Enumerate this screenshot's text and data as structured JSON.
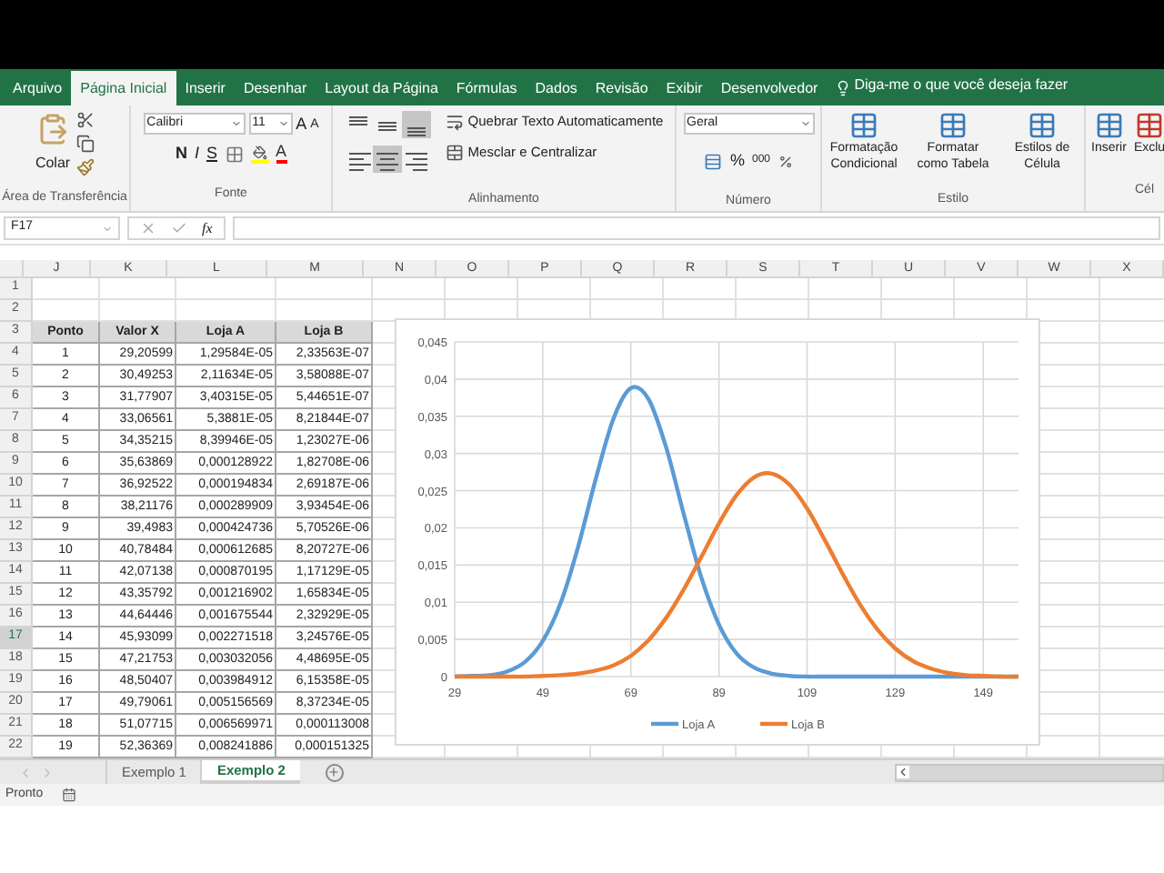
{
  "ribbon_tabs": [
    {
      "label": "Arquivo",
      "selected": false
    },
    {
      "label": "Página Inicial",
      "selected": true
    },
    {
      "label": "Inserir",
      "selected": false
    },
    {
      "label": "Desenhar",
      "selected": false
    },
    {
      "label": "Layout da Página",
      "selected": false
    },
    {
      "label": "Fórmulas",
      "selected": false
    },
    {
      "label": "Dados",
      "selected": false
    },
    {
      "label": "Revisão",
      "selected": false
    },
    {
      "label": "Exibir",
      "selected": false
    },
    {
      "label": "Desenvolvedor",
      "selected": false
    }
  ],
  "tell_me": "Diga-me o que você deseja fazer",
  "clipboard": {
    "paste": "Colar",
    "label": "Área de Transferência"
  },
  "font": {
    "name": "Calibri",
    "size": "11",
    "grow": "A",
    "shrink": "A",
    "bold": "N",
    "italic": "I",
    "underline": "S",
    "color_letter": "A",
    "label": "Fonte"
  },
  "alignment": {
    "wrap": "Quebrar Texto Automaticamente",
    "merge": "Mesclar e Centralizar",
    "label": "Alinhamento",
    "vertical_align": [
      {
        "selected": false
      },
      {
        "selected": false
      },
      {
        "selected": true
      }
    ],
    "horizontal_align": [
      {
        "selected": false
      },
      {
        "selected": true
      },
      {
        "selected": false
      }
    ]
  },
  "number": {
    "format": "Geral",
    "percent": "%",
    "thousands": "000",
    "label": "Número"
  },
  "styles": {
    "conditional": "Formatação Condicional",
    "table": "Formatar como Tabela",
    "cell": "Estilos de Célula",
    "label": "Estilo"
  },
  "cells": {
    "insert": "Inserir",
    "delete": "Exclu",
    "label": "Cél"
  },
  "formula_bar": {
    "name_box": "F17",
    "fx": "fx"
  },
  "columns": [
    "J",
    "K",
    "L",
    "M",
    "N",
    "O",
    "P",
    "Q",
    "R",
    "S",
    "T",
    "U",
    "V",
    "W",
    "X"
  ],
  "rows": [
    {
      "number": "1",
      "selected": false,
      "kind": "data",
      "cells": []
    },
    {
      "number": "2",
      "selected": false,
      "kind": "data",
      "cells": []
    },
    {
      "number": "3",
      "selected": false,
      "kind": "header",
      "cells": [
        "Ponto",
        "Valor X",
        "Loja A",
        "Loja B"
      ]
    },
    {
      "number": "4",
      "selected": false,
      "kind": "data",
      "cells": [
        "1",
        "29,20599",
        "1,29584E-05",
        "2,33563E-07"
      ]
    },
    {
      "number": "5",
      "selected": false,
      "kind": "data",
      "cells": [
        "2",
        "30,49253",
        "2,11634E-05",
        "3,58088E-07"
      ]
    },
    {
      "number": "6",
      "selected": false,
      "kind": "data",
      "cells": [
        "3",
        "31,77907",
        "3,40315E-05",
        "5,44651E-07"
      ]
    },
    {
      "number": "7",
      "selected": false,
      "kind": "data",
      "cells": [
        "4",
        "33,06561",
        "5,3881E-05",
        "8,21844E-07"
      ]
    },
    {
      "number": "8",
      "selected": false,
      "kind": "data",
      "cells": [
        "5",
        "34,35215",
        "8,39946E-05",
        "1,23027E-06"
      ]
    },
    {
      "number": "9",
      "selected": false,
      "kind": "data",
      "cells": [
        "6",
        "35,63869",
        "0,000128922",
        "1,82708E-06"
      ]
    },
    {
      "number": "10",
      "selected": false,
      "kind": "data",
      "cells": [
        "7",
        "36,92522",
        "0,000194834",
        "2,69187E-06"
      ]
    },
    {
      "number": "11",
      "selected": false,
      "kind": "data",
      "cells": [
        "8",
        "38,21176",
        "0,000289909",
        "3,93454E-06"
      ]
    },
    {
      "number": "12",
      "selected": false,
      "kind": "data",
      "cells": [
        "9",
        "39,4983",
        "0,000424736",
        "5,70526E-06"
      ]
    },
    {
      "number": "13",
      "selected": false,
      "kind": "data",
      "cells": [
        "10",
        "40,78484",
        "0,000612685",
        "8,20727E-06"
      ]
    },
    {
      "number": "14",
      "selected": false,
      "kind": "data",
      "cells": [
        "11",
        "42,07138",
        "0,000870195",
        "1,17129E-05"
      ]
    },
    {
      "number": "15",
      "selected": false,
      "kind": "data",
      "cells": [
        "12",
        "43,35792",
        "0,001216902",
        "1,65834E-05"
      ]
    },
    {
      "number": "16",
      "selected": false,
      "kind": "data",
      "cells": [
        "13",
        "44,64446",
        "0,001675544",
        "2,32929E-05"
      ]
    },
    {
      "number": "17",
      "selected": true,
      "kind": "data",
      "cells": [
        "14",
        "45,93099",
        "0,002271518",
        "3,24576E-05"
      ]
    },
    {
      "number": "18",
      "selected": false,
      "kind": "data",
      "cells": [
        "15",
        "47,21753",
        "0,003032056",
        "4,48695E-05"
      ]
    },
    {
      "number": "19",
      "selected": false,
      "kind": "data",
      "cells": [
        "16",
        "48,50407",
        "0,003984912",
        "6,15358E-05"
      ]
    },
    {
      "number": "20",
      "selected": false,
      "kind": "data",
      "cells": [
        "17",
        "49,79061",
        "0,005156569",
        "8,37234E-05"
      ]
    },
    {
      "number": "21",
      "selected": false,
      "kind": "data",
      "cells": [
        "18",
        "51,07715",
        "0,006569971",
        "0,000113008"
      ]
    },
    {
      "number": "22",
      "selected": false,
      "kind": "data",
      "cells": [
        "19",
        "52,36369",
        "0,008241886",
        "0,000151325"
      ]
    }
  ],
  "chart": {
    "chart_data": {
      "type": "line",
      "x": [
        29,
        33,
        37,
        41,
        45,
        49,
        53,
        57,
        61,
        65,
        69,
        73,
        77,
        81,
        85,
        89,
        93,
        97,
        101,
        105,
        109,
        113,
        117,
        121,
        125,
        129,
        133,
        137,
        141,
        145,
        149,
        153,
        157
      ],
      "series": [
        {
          "name": "Loja A",
          "color": "#5b9bd5",
          "values": [
            0,
            0.0001,
            0.0002,
            0.0007,
            0.002,
            0.0048,
            0.0098,
            0.0174,
            0.0265,
            0.0346,
            0.0388,
            0.0373,
            0.0308,
            0.0219,
            0.0133,
            0.007,
            0.0031,
            0.0012,
            0.0004,
            0.0001,
            0,
            0,
            0,
            0,
            0,
            0,
            0,
            0,
            0,
            0,
            0,
            0,
            0
          ]
        },
        {
          "name": "Loja B",
          "color": "#ed7d31",
          "values": [
            0,
            0,
            0,
            0,
            0,
            0.0001,
            0.0002,
            0.0004,
            0.0008,
            0.0015,
            0.0028,
            0.0049,
            0.0079,
            0.0117,
            0.0161,
            0.0206,
            0.0244,
            0.0268,
            0.0273,
            0.0258,
            0.0226,
            0.0184,
            0.0139,
            0.0097,
            0.0063,
            0.0038,
            0.0021,
            0.0011,
            0.0005,
            0.0002,
            0.0001,
            0,
            0
          ]
        }
      ],
      "grid": true,
      "legend": "bottom",
      "xlim": [
        29,
        157
      ],
      "ylim": [
        0,
        0.045
      ],
      "xticks": [
        29,
        49,
        69,
        89,
        109,
        129,
        149
      ],
      "yticks": [
        {
          "value": 0,
          "label": "0"
        },
        {
          "value": 0.005,
          "label": "0,005"
        },
        {
          "value": 0.01,
          "label": "0,01"
        },
        {
          "value": 0.015,
          "label": "0,015"
        },
        {
          "value": 0.02,
          "label": "0,02"
        },
        {
          "value": 0.025,
          "label": "0,025"
        },
        {
          "value": 0.03,
          "label": "0,03"
        },
        {
          "value": 0.035,
          "label": "0,035"
        },
        {
          "value": 0.04,
          "label": "0,04"
        },
        {
          "value": 0.045,
          "label": "0,045"
        }
      ]
    }
  },
  "sheets": [
    {
      "label": "Exemplo 1",
      "selected": false
    },
    {
      "label": "Exemplo 2",
      "selected": true
    }
  ],
  "status": "Pronto"
}
